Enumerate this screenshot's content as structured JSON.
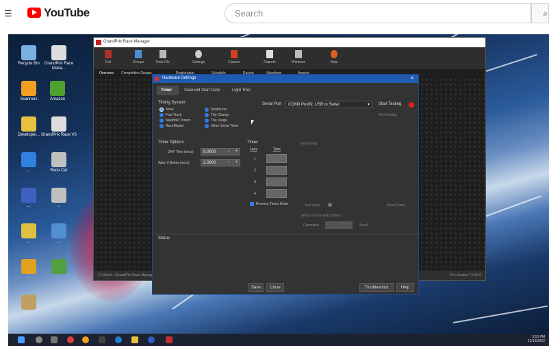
{
  "youtube": {
    "logo_text": "YouTube",
    "search_placeholder": "Search",
    "menu_icon": "hamburger-icon",
    "search_icon": "search-icon"
  },
  "desktop_icons": [
    {
      "label": "Recycle Bin",
      "icon": "recycle-bin-icon",
      "color": "#7ab0e0"
    },
    {
      "label": "GrandPrix Race Mana...",
      "icon": "checkered-flag-icon",
      "color": "#dddddd"
    },
    {
      "label": "Scanners",
      "icon": "scanner-icon",
      "color": "#f0a020"
    },
    {
      "label": "Amazon",
      "icon": "tool-icon",
      "color": "#50a030"
    },
    {
      "label": "Developer...",
      "icon": "developer-icon",
      "color": "#e8c040"
    },
    {
      "label": "GrandPrix Race V3",
      "icon": "checkered-flag-icon",
      "color": "#dddddd"
    },
    {
      "label": "...",
      "icon": "app-icon",
      "color": "#3080e0"
    },
    {
      "label": "Race Car",
      "icon": "race-car-icon",
      "color": "#c0c0c0"
    },
    {
      "label": "...",
      "icon": "file-icon",
      "color": "#4060c0"
    },
    {
      "label": "...",
      "icon": "race-car-icon",
      "color": "#c0c0c0"
    },
    {
      "label": "...",
      "icon": "file-icon",
      "color": "#e0c040"
    },
    {
      "label": "...",
      "icon": "app-icon",
      "color": "#5090d0"
    },
    {
      "label": "...",
      "icon": "file-icon",
      "color": "#e0a020"
    },
    {
      "label": "...",
      "icon": "chart-icon",
      "color": "#50a040"
    },
    {
      "label": "...",
      "icon": "file-icon",
      "color": "#c0a060"
    }
  ],
  "app": {
    "title": "GrandPrix Race Manager",
    "toolbar": [
      "Exit",
      "Groups",
      "Data File",
      "Settings",
      "Classes",
      "Reports",
      "Windows",
      "Help"
    ],
    "tabs": [
      "Overview",
      "Competition Groups",
      "Registration",
      "Schedule",
      "Racing",
      "Standings",
      "Awards"
    ],
    "status_left": "C:\\Users\\...\\GrandPrix Race Manager\\Data\\...",
    "status_right": "Pro Version 7.0.36.0"
  },
  "dialog": {
    "title": "Hardware Settings",
    "close": "✕",
    "tabs": [
      "Timer",
      "Solenoid Start Gate",
      "Light Tree"
    ],
    "active_tab": "Timer",
    "timing_system_label": "Timing System",
    "timers_left": [
      "None",
      "Fast Track",
      "NewBold Timers",
      "RaceMaster"
    ],
    "timers_right": [
      "SmartLine",
      "The Champ",
      "The Judge",
      "Other Serial Timer"
    ],
    "selected_timer": "None",
    "serial_port_label": "Serial Port",
    "serial_port_value": "COM3 Prolific USB to Serial",
    "start_testing": "Start Testing",
    "test_testing": "Test Testing",
    "timer_options_label": "Timer Options",
    "dnf_label": "DNF Time (secs)",
    "dnf_value": "9.0000",
    "warn_label": "Warn if Below (secs)",
    "warn_value": "2.0000",
    "times_label": "Times",
    "lane_header": "Lane",
    "time_header": "Time",
    "lanes": [
      "1",
      "2",
      "3",
      "4"
    ],
    "timer_data_label": "Timer Data",
    "reverse_label": "Reverse Times Order",
    "test_lines_label": "Test Lines",
    "reset_timer": "Reset Timer",
    "send_command_label": "Send a Command (Option)",
    "command_label": "Command",
    "send": "Send",
    "status_label": "Status",
    "save": "Save",
    "close_button": "Close",
    "troubleshoot": "Troubleshoot",
    "help": "Help"
  },
  "taskbar": {
    "time": "3:15 PM",
    "date": "12/13/2022"
  }
}
